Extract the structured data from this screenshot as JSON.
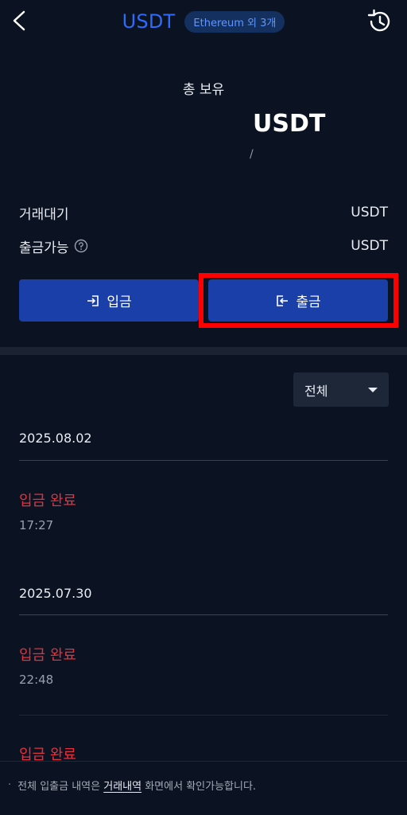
{
  "header": {
    "title": "USDT",
    "network_badge": "Ethereum 외 3개"
  },
  "summary": {
    "total_label": "총 보유",
    "total_unit": "USDT",
    "total_sub": "/"
  },
  "balances": [
    {
      "label": "거래대기",
      "unit": "USDT"
    },
    {
      "label": "출금가능",
      "unit": "USDT"
    }
  ],
  "actions": {
    "deposit_label": "입금",
    "withdraw_label": "출금"
  },
  "filter": {
    "selected": "전체"
  },
  "transactions": [
    {
      "date": "2025.08.02",
      "status": "입금 완료",
      "time": "17:27"
    },
    {
      "date": "2025.07.30",
      "status": "입금 완료",
      "time": "22:48"
    },
    {
      "status": "입금 완료"
    }
  ],
  "footer": {
    "prefix": "전체 입출금 내역은",
    "link": "거래내역",
    "suffix": "화면에서 확인가능합니다."
  },
  "colors": {
    "background": "#0b1322",
    "accent": "#2d6bff",
    "button": "#1a3fa8",
    "status_deposit": "#e2323e",
    "highlight": "#ff0000"
  },
  "icons": [
    "back-arrow-icon",
    "history-icon",
    "help-icon",
    "deposit-icon",
    "withdraw-icon",
    "chevron-down-icon"
  ]
}
